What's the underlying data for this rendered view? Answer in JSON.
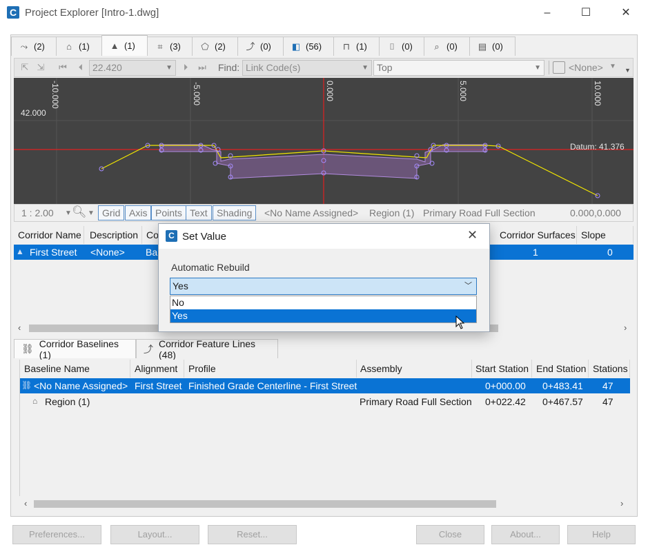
{
  "window": {
    "title": "Project Explorer [Intro-1.dwg]",
    "minimize": "–",
    "maximize": "☐",
    "close": "✕"
  },
  "tabs": [
    {
      "icon": "alignment-icon",
      "count": "(2)"
    },
    {
      "icon": "assembly-icon",
      "count": "(1)"
    },
    {
      "icon": "corridor-icon",
      "count": "(1)"
    },
    {
      "icon": "pipe-network-icon",
      "count": "(3)"
    },
    {
      "icon": "surface-icon",
      "count": "(2)"
    },
    {
      "icon": "feature-line-icon",
      "count": "(0)"
    },
    {
      "icon": "point-group-icon",
      "count": "(56)"
    },
    {
      "icon": "subassembly-icon",
      "count": "(1)"
    },
    {
      "icon": "sample-line-icon",
      "count": "(0)"
    },
    {
      "icon": "label-icon",
      "count": "(0)"
    },
    {
      "icon": "sheet-icon",
      "count": "(0)"
    }
  ],
  "toolbar": {
    "station": "22.420",
    "find_label": "Find:",
    "find_value": "Link Code(s)",
    "view": "Top",
    "style": "<None>"
  },
  "viewer": {
    "tick_labels": [
      "-10.000",
      "-5.000",
      "0.000",
      "5.000",
      "10.000"
    ],
    "elevation_label": "42.000",
    "datum_label": "Datum: 41.376"
  },
  "statusbar": {
    "scale": "1 : 2.00",
    "grid": "Grid",
    "axis": "Axis",
    "points": "Points",
    "text": "Text",
    "shading": "Shading",
    "name": "<No Name Assigned>",
    "region": "Region (1)",
    "assembly": "Primary Road Full Section",
    "coords": "0.000,0.000"
  },
  "corridor_table": {
    "columns": [
      "Corridor Name",
      "Description",
      "Co",
      "",
      "Corridor Surfaces",
      "Slope Pattern"
    ],
    "row": {
      "name": "First Street",
      "description": "<None>",
      "base": "Ba",
      "surfaces": "1",
      "slope": "0"
    }
  },
  "bottom_tabs": {
    "baselines": "Corridor Baselines (1)",
    "feature_lines": "Corridor Feature Lines (48)"
  },
  "baseline_table": {
    "columns": [
      "Baseline Name",
      "Alignment",
      "Profile",
      "Assembly",
      "Start Station",
      "End Station",
      "Stations"
    ],
    "rows": [
      {
        "name": "<No Name Assigned>",
        "alignment": "First Street",
        "profile": "Finished Grade Centerline - First Street",
        "assembly": "",
        "start": "0+000.00",
        "end": "0+483.41",
        "stations": "47"
      },
      {
        "name": "Region (1)",
        "alignment": "",
        "profile": "",
        "assembly": "Primary Road Full Section",
        "start": "0+022.42",
        "end": "0+467.57",
        "stations": "47"
      }
    ]
  },
  "footer": {
    "preferences": "Preferences...",
    "layout": "Layout...",
    "reset": "Reset...",
    "close": "Close",
    "about": "About...",
    "help": "Help"
  },
  "dialog": {
    "title": "Set Value",
    "label": "Automatic Rebuild",
    "selected": "Yes",
    "options": [
      "No",
      "Yes"
    ]
  }
}
